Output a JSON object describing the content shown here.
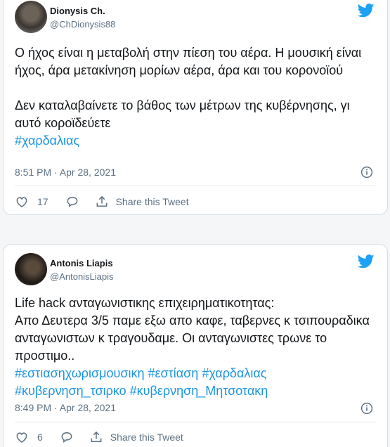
{
  "colors": {
    "link": "#1b95e0",
    "text": "#14171a",
    "muted": "#5b7083",
    "brand": "#1da1f2"
  },
  "tweets": [
    {
      "author_name": "Dionysis Ch.",
      "author_handle": "@ChDionysis88",
      "body_lines": [
        "Ο ήχος είναι η μεταβολή στην πίεση του αέρα. Η μουσική είναι ήχος, άρα μετακίνηση μορίων αέρα, άρα και του κορονοϊού",
        "Δεν καταλαβαίνετε το βάθος των μέτρων της κυβέρνησης, γι αυτό κοροϊδεύετε"
      ],
      "hashtags": [
        "#χαρδαλιας"
      ],
      "timestamp": "8:51 PM · Apr 28, 2021",
      "like_count": "17",
      "share_label": "Share this Tweet",
      "icons": [
        "twitter-bird-icon",
        "info-icon",
        "heart-icon",
        "reply-icon",
        "share-icon"
      ]
    },
    {
      "author_name": "Antonis Liapis",
      "author_handle": "@AntonisLiapis",
      "body_lines": [
        "Life hack ανταγωνιστικης επιχειρηματικοτητας:",
        " Απο Δευτερα 3/5 παμε εξω απο καφε, ταβερνες κ τσιπουραδικα ανταγωνιστων κ τραγουδαμε. Οι ανταγωνιστες τρωνε το προστιμο.."
      ],
      "hashtags": [
        "#εστιασηχωρισμουσικη",
        "#εστίαση",
        "#χαρδαλιας",
        "#κυβερνηση_τσιρκο",
        "#κυβερνηση_Μητσοτακη"
      ],
      "timestamp": "8:49 PM · Apr 28, 2021",
      "like_count": "6",
      "share_label": "Share this Tweet",
      "icons": [
        "twitter-bird-icon",
        "info-icon",
        "heart-icon",
        "reply-icon",
        "share-icon"
      ]
    }
  ]
}
